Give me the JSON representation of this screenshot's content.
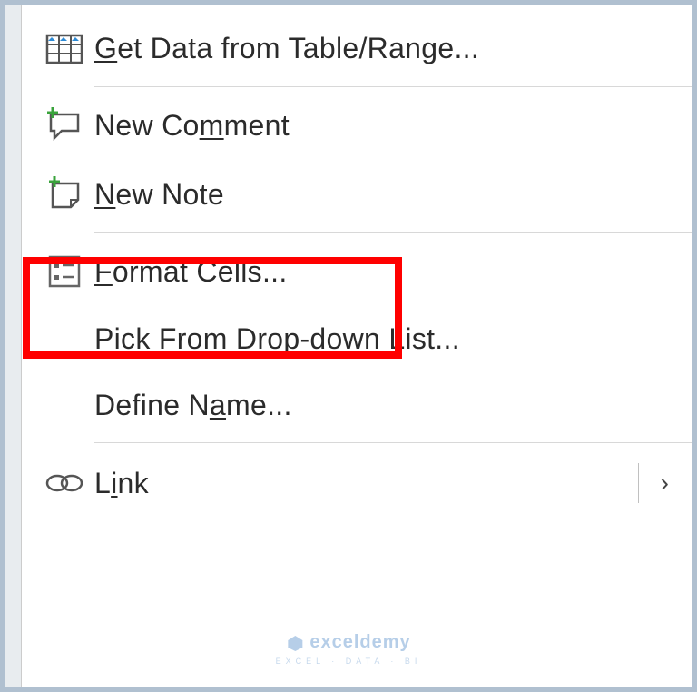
{
  "menu": {
    "get_data": {
      "pre": "",
      "u": "G",
      "post": "et Data from Table/Range..."
    },
    "new_comment": {
      "pre": "New Co",
      "u": "m",
      "post": "ment"
    },
    "new_note": {
      "pre": "",
      "u": "N",
      "post": "ew Note"
    },
    "format_cells": {
      "pre": "",
      "u": "F",
      "post": "ormat Cells..."
    },
    "pick_list": {
      "pre": "Pic",
      "u": "k",
      "post": " From Drop-down List..."
    },
    "define_name": {
      "pre": "Define N",
      "u": "a",
      "post": "me..."
    },
    "link": {
      "pre": "L",
      "u": "i",
      "post": "nk"
    }
  },
  "watermark": {
    "brand": "exceldemy",
    "tagline": "EXCEL · DATA · BI"
  },
  "icons": {
    "arrow": "›"
  }
}
